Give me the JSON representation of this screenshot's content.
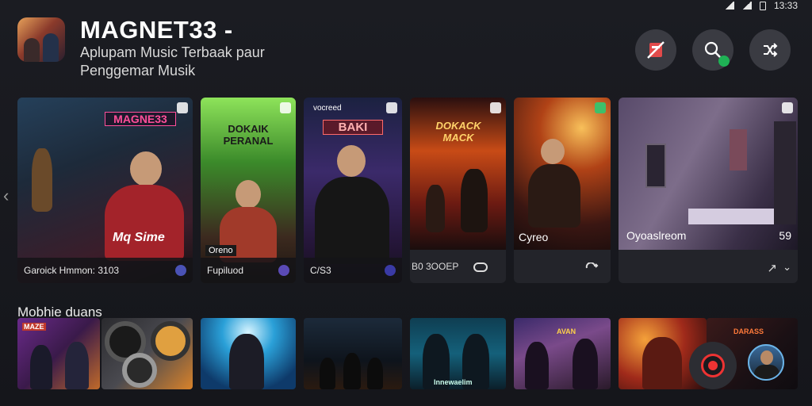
{
  "status_bar": {
    "time": "13:33"
  },
  "header": {
    "title": "MAGNET33 -",
    "subtitle": "Aplupam Music Terbaak paur Penggemar Musik"
  },
  "icons": {
    "no_ads": "no-ads-icon",
    "search": "search-icon",
    "shuffle": "shuffle-icon"
  },
  "featured": [
    {
      "top_text": "MAGNE33",
      "sign": "Mq Sime",
      "caption": "Garoick Hmmon: 3103",
      "style": "neon"
    },
    {
      "top_text": "DOKAIK PERANAL",
      "sign": "",
      "tag": "Oreno",
      "caption": "Fupiluod",
      "style": "green"
    },
    {
      "top_text": "BAKI",
      "header_small": "vocreed",
      "caption": "C/S3",
      "style": "purple"
    },
    {
      "top_text": "DOKACK MACK",
      "caption": "B0 3OOEP",
      "style": "fire"
    },
    {
      "top_text": "",
      "caption": "Cyreo",
      "style": "stage"
    },
    {
      "top_text": "",
      "caption": "Oyoaslreom",
      "caption_right": "59",
      "style": "studio"
    }
  ],
  "section_title": "Mobhie duans",
  "thumbnails": [
    {
      "sign": "MAZE"
    },
    {
      "sign": ""
    },
    {
      "sign": ""
    },
    {
      "sign": ""
    },
    {
      "sign": "Innewaelim"
    },
    {
      "sign": "AVAN"
    },
    {
      "sign": ""
    },
    {
      "sign": "DARASS"
    }
  ],
  "colors": {
    "background": "#1b1c22",
    "accent_green": "#1fb255",
    "record_red": "#ee3333"
  }
}
